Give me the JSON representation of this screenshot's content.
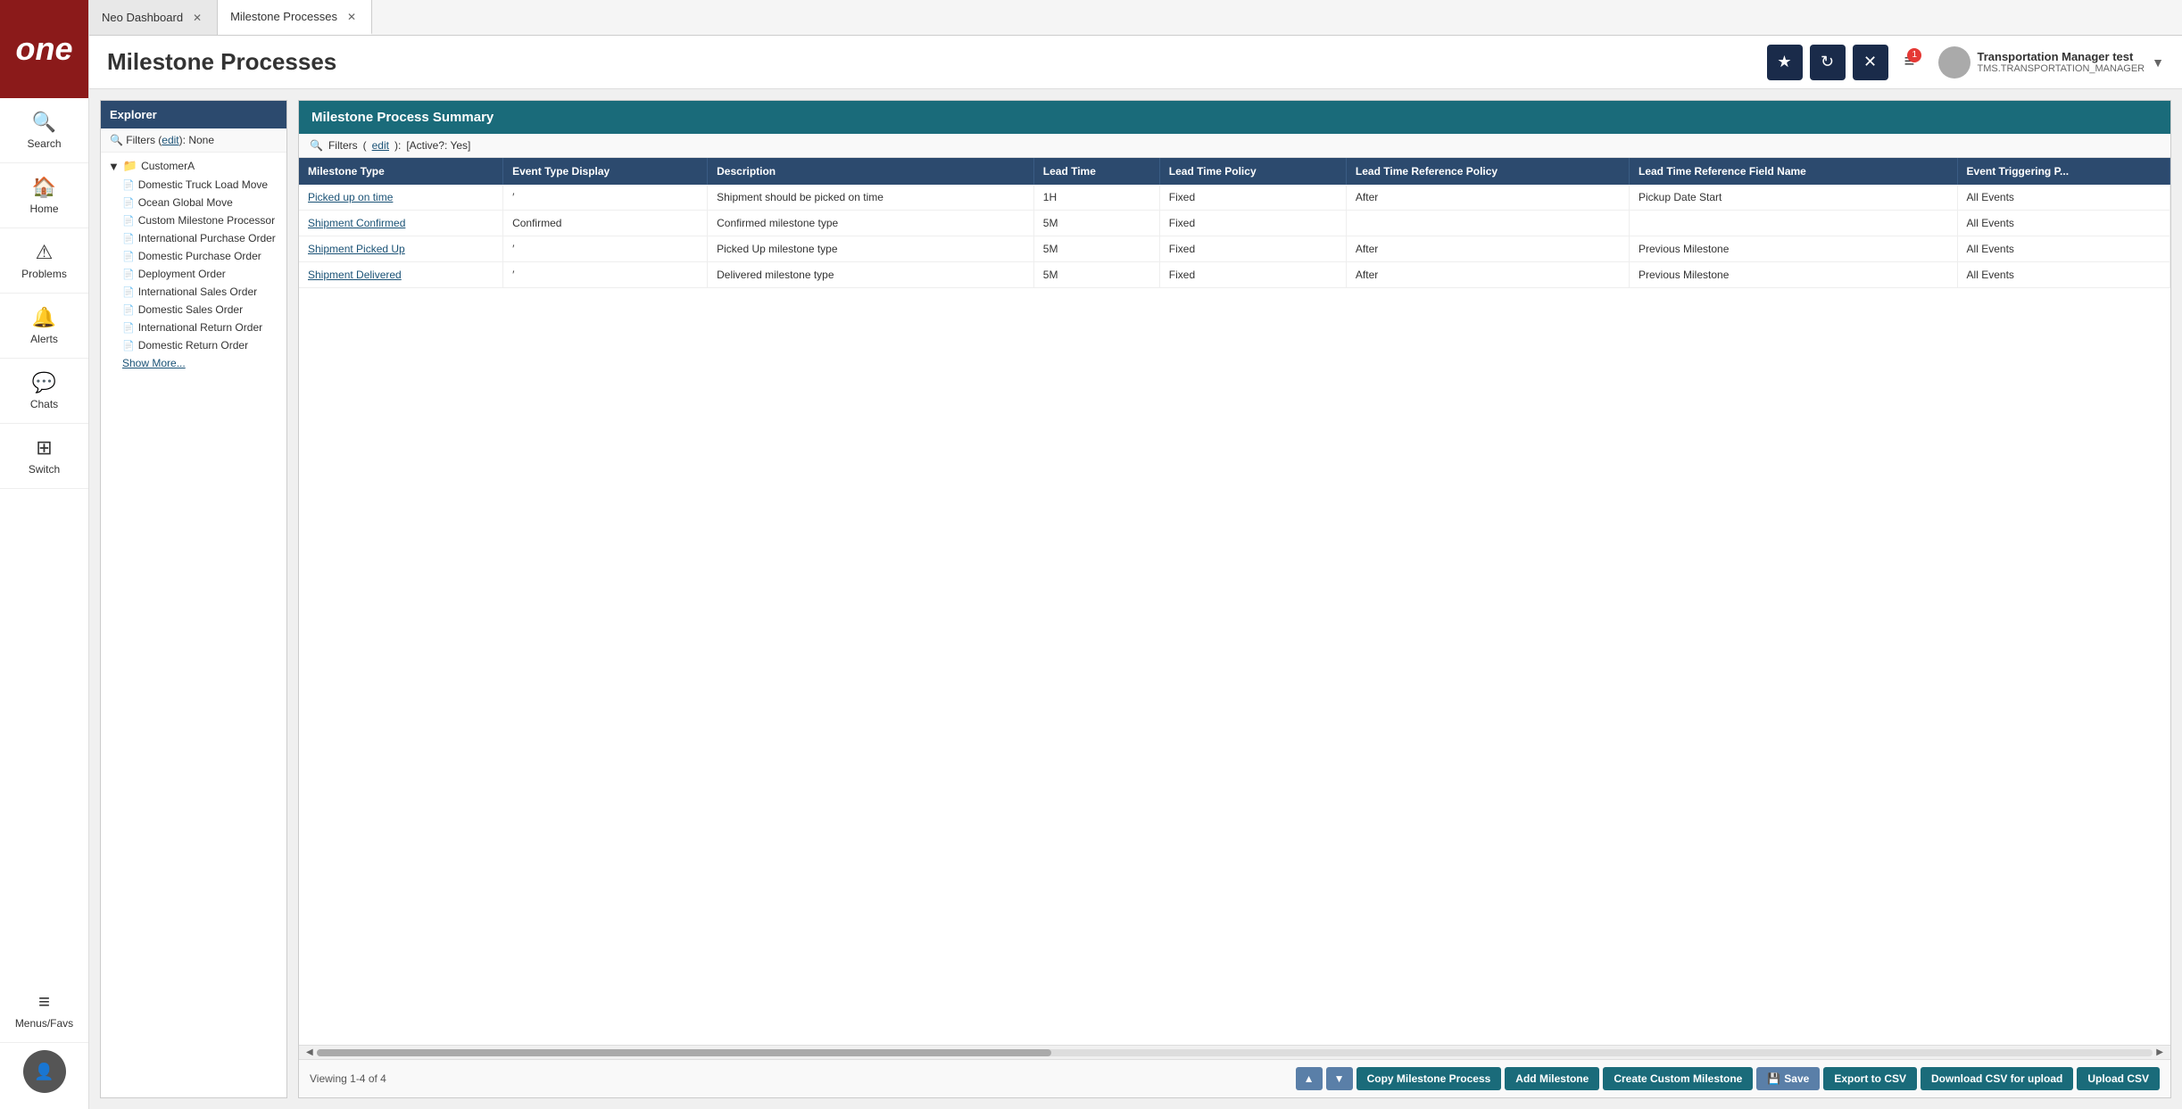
{
  "app": {
    "logo": "one",
    "tabs": [
      {
        "label": "Neo Dashboard",
        "active": false,
        "closable": true
      },
      {
        "label": "Milestone Processes",
        "active": true,
        "closable": true
      }
    ]
  },
  "header": {
    "title": "Milestone Processes",
    "buttons": {
      "star": "★",
      "refresh": "↻",
      "close": "✕",
      "menu": "≡"
    },
    "user": {
      "name": "Transportation Manager test",
      "role": "TMS.TRANSPORTATION_MANAGER"
    },
    "notification_count": "1"
  },
  "sidebar": {
    "items": [
      {
        "id": "search",
        "icon": "🔍",
        "label": "Search"
      },
      {
        "id": "home",
        "icon": "🏠",
        "label": "Home"
      },
      {
        "id": "problems",
        "icon": "⚠",
        "label": "Problems"
      },
      {
        "id": "alerts",
        "icon": "🔔",
        "label": "Alerts"
      },
      {
        "id": "chats",
        "icon": "💬",
        "label": "Chats"
      },
      {
        "id": "switch",
        "icon": "⊞",
        "label": "Switch"
      }
    ],
    "bottom": {
      "menus": {
        "icon": "≡",
        "label": "Menus/Favs"
      }
    }
  },
  "explorer": {
    "title": "Explorer",
    "filters_label": "Filters",
    "filters_edit": "edit",
    "filters_value": "None",
    "folder": "CustomerA",
    "items": [
      "Domestic Truck Load Move",
      "Ocean Global Move",
      "Custom Milestone Processor",
      "International Purchase Order",
      "Domestic Purchase Order",
      "Deployment Order",
      "International Sales Order",
      "Domestic Sales Order",
      "International Return Order",
      "Domestic Return Order"
    ],
    "show_more": "Show More..."
  },
  "milestone_table": {
    "panel_title": "Milestone Process Summary",
    "filters_label": "Filters",
    "filters_edit": "edit",
    "filters_active": "[Active?: Yes]",
    "columns": [
      "Milestone Type",
      "Event Type Display",
      "Description",
      "Lead Time",
      "Lead Time Policy",
      "Lead Time Reference Policy",
      "Lead Time Reference Field Name",
      "Event Triggering P..."
    ],
    "rows": [
      {
        "milestone_type": "Picked up on time",
        "event_type_display": "′",
        "description": "Shipment should be picked on time",
        "lead_time": "1H",
        "lead_time_policy": "Fixed",
        "lead_time_ref_policy": "After",
        "lead_time_ref_field": "Pickup Date Start",
        "event_triggering": "All Events"
      },
      {
        "milestone_type": "Shipment Confirmed",
        "event_type_display": "Confirmed",
        "description": "Confirmed milestone type",
        "lead_time": "5M",
        "lead_time_policy": "Fixed",
        "lead_time_ref_policy": "",
        "lead_time_ref_field": "",
        "event_triggering": "All Events"
      },
      {
        "milestone_type": "Shipment Picked Up",
        "event_type_display": "′",
        "description": "Picked Up milestone type",
        "lead_time": "5M",
        "lead_time_policy": "Fixed",
        "lead_time_ref_policy": "After",
        "lead_time_ref_field": "Previous Milestone",
        "event_triggering": "All Events"
      },
      {
        "milestone_type": "Shipment Delivered",
        "event_type_display": "′",
        "description": "Delivered milestone type",
        "lead_time": "5M",
        "lead_time_policy": "Fixed",
        "lead_time_ref_policy": "After",
        "lead_time_ref_field": "Previous Milestone",
        "event_triggering": "All Events"
      }
    ],
    "viewing": "Viewing 1-4 of 4",
    "buttons": {
      "copy_milestone_process": "Copy Milestone Process",
      "add_milestone": "Add Milestone",
      "create_custom_milestone": "Create Custom Milestone",
      "save": "Save",
      "export_to_csv": "Export to CSV",
      "download_csv": "Download CSV for upload",
      "upload_csv": "Upload CSV"
    }
  }
}
